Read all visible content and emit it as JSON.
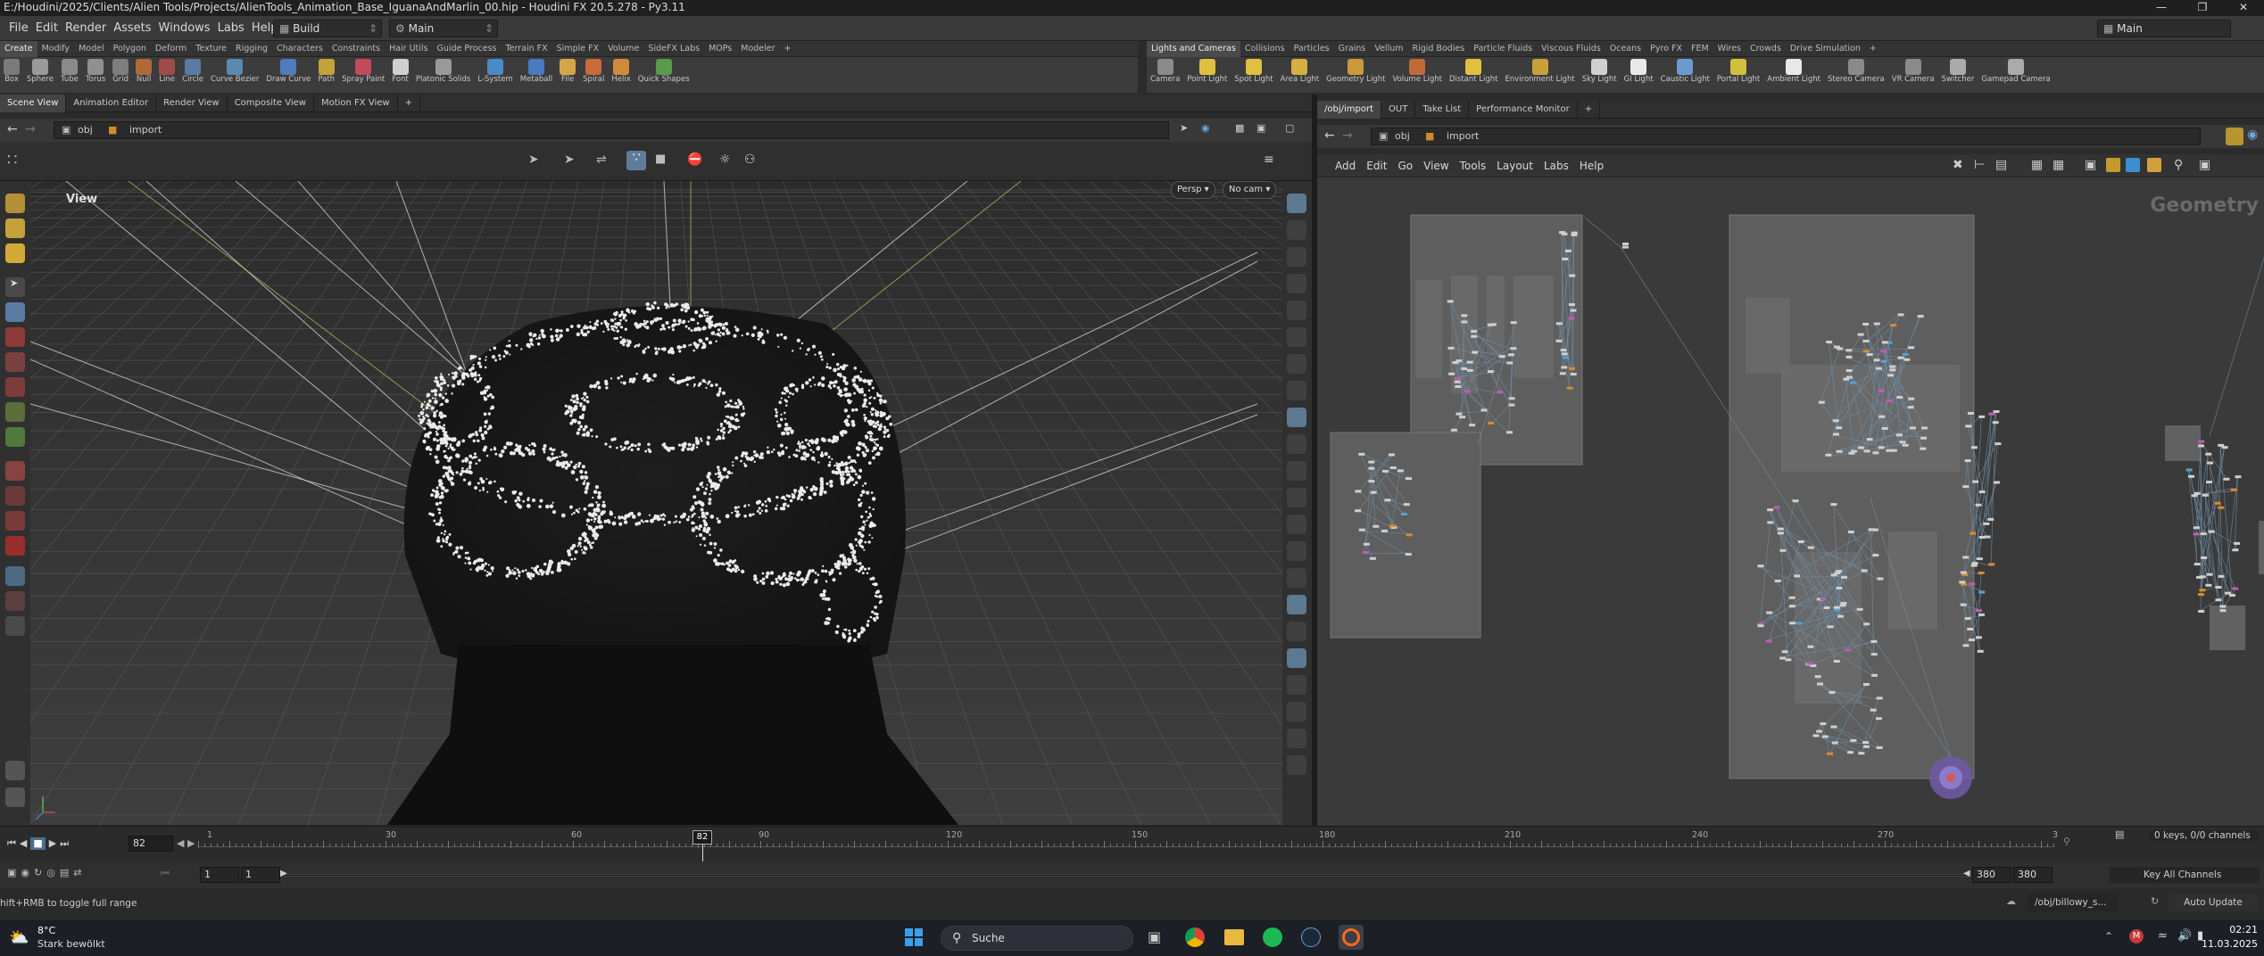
{
  "window": {
    "title": "E:/Houdini/2025/Clients/Alien Tools/Projects/AlienTools_Animation_Base_IguanaAndMarlin_00.hip - Houdini FX 20.5.278 - Py3.11"
  },
  "menubar": {
    "items": [
      "File",
      "Edit",
      "Render",
      "Assets",
      "Windows",
      "Labs",
      "Help"
    ],
    "desktop_select": "Build",
    "context_select": "Main",
    "right_select": "Main"
  },
  "shelf_left": {
    "tabs": [
      "Create",
      "Modify",
      "Model",
      "Polygon",
      "Deform",
      "Texture",
      "Rigging",
      "Characters",
      "Constraints",
      "Hair Utils",
      "Guide Process",
      "Terrain FX",
      "Simple FX",
      "Volume",
      "SideFX Labs",
      "MOPs",
      "Modeler"
    ],
    "active_tab": 0,
    "tools": [
      "Box",
      "Sphere",
      "Tube",
      "Torus",
      "Grid",
      "Null",
      "Line",
      "Circle",
      "Curve Bezier",
      "Draw Curve",
      "Path",
      "Spray Paint",
      "Font",
      "Platonic Solids",
      "L-System",
      "Metaball",
      "File",
      "Spiral",
      "Helix",
      "Quick Shapes"
    ]
  },
  "shelf_right": {
    "tabs": [
      "Lights and Cameras",
      "Collisions",
      "Particles",
      "Grains",
      "Vellum",
      "Rigid Bodies",
      "Particle Fluids",
      "Viscous Fluids",
      "Oceans",
      "Pyro FX",
      "FEM",
      "Wires",
      "Crowds",
      "Drive Simulation"
    ],
    "active_tab": 0,
    "tools": [
      "Camera",
      "Point Light",
      "Spot Light",
      "Area Light",
      "Geometry Light",
      "Volume Light",
      "Distant Light",
      "Environment Light",
      "Sky Light",
      "GI Light",
      "Caustic Light",
      "Portal Light",
      "Ambient Light",
      "Stereo Camera",
      "VR Camera",
      "Switcher",
      "Gamepad Camera"
    ]
  },
  "left_pane": {
    "tabs": [
      "Scene View",
      "Animation Editor",
      "Render View",
      "Composite View",
      "Motion FX View"
    ],
    "active_tab": 0,
    "path": [
      "obj",
      "import"
    ],
    "viewport_label": "View",
    "persp_btn": "Persp",
    "cam_btn": "No cam"
  },
  "right_pane": {
    "tabs": [
      "/obj/import",
      "OUT",
      "Take List",
      "Performance Monitor"
    ],
    "active_tab": 0,
    "path": [
      "obj",
      "import"
    ],
    "menu": [
      "Add",
      "Edit",
      "Go",
      "View",
      "Tools",
      "Layout",
      "Labs",
      "Help"
    ],
    "network_label": "Geometry"
  },
  "timeline": {
    "current_frame": "82",
    "marker_label": "82",
    "ticks": [
      "1",
      "30",
      "60",
      "90",
      "120",
      "150",
      "180",
      "210",
      "240",
      "270",
      "3"
    ],
    "keys_info": "0 keys, 0/0 channels",
    "key_all_channels": "Key All Channels"
  },
  "range": {
    "start": "1",
    "start2": "1",
    "end": "380",
    "end2": "380"
  },
  "status": {
    "hint": "hift+RMB to toggle full range",
    "path_field": "/obj/billowy_s...",
    "auto_update": "Auto Update"
  },
  "taskbar": {
    "weather_temp": "8°C",
    "weather_desc": "Stark bewölkt",
    "search_label": "Suche",
    "time": "02:21",
    "date": "11.03.2025"
  },
  "colors": {
    "accent": "#3a8fd0",
    "viewport_bg": "#3b3b3b",
    "network_bg": "#3a3a3a"
  }
}
